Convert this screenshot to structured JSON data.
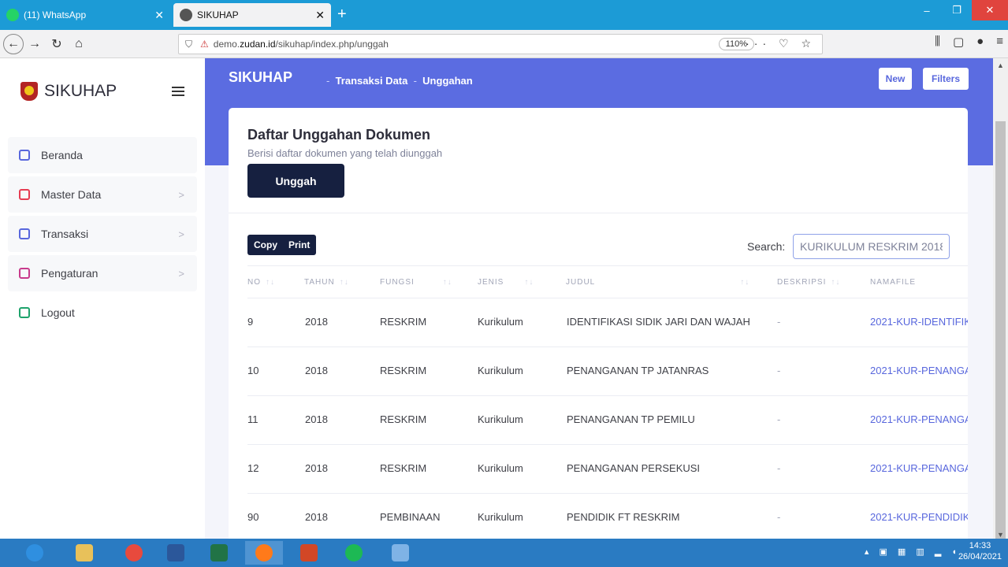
{
  "browser": {
    "tabs": [
      {
        "title": "(11) WhatsApp",
        "icon": "whatsapp-icon",
        "color": "#25d366"
      },
      {
        "title": "SIKUHAP",
        "icon": "site-favicon",
        "color": "#555555"
      }
    ],
    "url_prefix": "demo.",
    "url_domain": "zudan.id",
    "url_path": "/sikuhap/index.php/unggah",
    "zoom": "110%"
  },
  "sidebar": {
    "brand": "SIKUHAP",
    "items": [
      {
        "label": "Beranda",
        "arrow": ""
      },
      {
        "label": "Master Data",
        "arrow": ">"
      },
      {
        "label": "Transaksi",
        "arrow": ">"
      },
      {
        "label": "Pengaturan",
        "arrow": ">"
      },
      {
        "label": "Logout",
        "arrow": ""
      }
    ]
  },
  "header": {
    "title": "SIKUHAP",
    "breadcrumb_sep1": "-",
    "breadcrumb_1": "Transaksi Data",
    "breadcrumb_sep2": "-",
    "breadcrumb_2": "Unggahan",
    "new_label": "New",
    "filters_label": "Filters",
    "color": "#5b6ce1"
  },
  "card": {
    "title": "Daftar Unggahan Dokumen",
    "subtitle": "Berisi daftar dokumen yang telah diunggah",
    "upload_label": "Unggah",
    "copy_label": "Copy",
    "print_label": "Print",
    "search_label": "Search:",
    "search_value": "KURIKULUM RESKRIM 2018"
  },
  "table": {
    "columns": [
      "NO",
      "TAHUN",
      "FUNGSI",
      "JENIS",
      "JUDUL",
      "DESKRIPSI",
      "NAMAFILE"
    ],
    "rows": [
      [
        "9",
        "2018",
        "RESKRIM",
        "Kurikulum",
        "IDENTIFIKASI SIDIK JARI DAN WAJAH",
        "-",
        "2021-KUR-IDENTIFIK"
      ],
      [
        "10",
        "2018",
        "RESKRIM",
        "Kurikulum",
        "PENANGANAN TP JATANRAS",
        "-",
        "2021-KUR-PENANGA"
      ],
      [
        "11",
        "2018",
        "RESKRIM",
        "Kurikulum",
        "PENANGANAN TP PEMILU",
        "-",
        "2021-KUR-PENANGA"
      ],
      [
        "12",
        "2018",
        "RESKRIM",
        "Kurikulum",
        "PENANGANAN PERSEKUSI",
        "-",
        "2021-KUR-PENANGA"
      ],
      [
        "90",
        "2018",
        "PEMBINAAN",
        "Kurikulum",
        "PENDIDIK FT RESKRIM",
        "-",
        "2021-KUR-PENDIDIK"
      ]
    ]
  },
  "taskbar": {
    "time": "14:33",
    "date": "26/04/2021"
  }
}
